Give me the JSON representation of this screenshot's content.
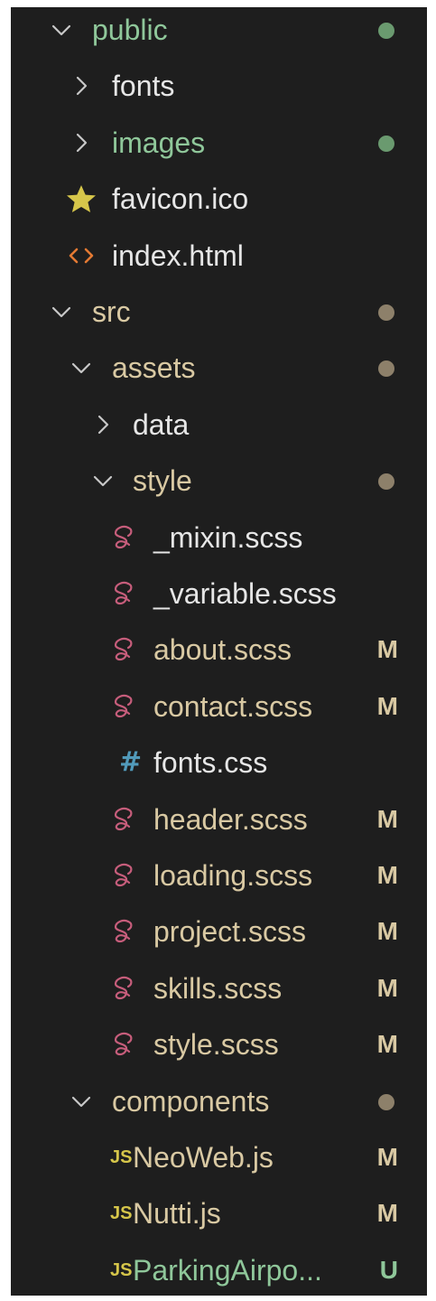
{
  "colors": {
    "bg": "#1e1e1e",
    "green": "#8fc79a",
    "green_dot": "#6a9a6f",
    "tan": "#d9c9a3",
    "tan_dot": "#8d806a",
    "white": "#e6e6e6",
    "chevron": "#c8c8c8",
    "sass": "#c65d7b",
    "js": "#d6c64a",
    "css": "#519aba",
    "star": "#d6c64a",
    "html": "#e37933",
    "badge_m": "#d9c9a3",
    "badge_u": "#8fc79a"
  },
  "rows": [
    {
      "label": "public",
      "depth": 0,
      "type": "folder",
      "open": true,
      "color": "green",
      "dot": "green_dot"
    },
    {
      "label": "fonts",
      "depth": 1,
      "type": "folder",
      "open": false,
      "color": "white"
    },
    {
      "label": "images",
      "depth": 1,
      "type": "folder",
      "open": false,
      "color": "green",
      "dot": "green_dot"
    },
    {
      "label": "favicon.ico",
      "depth": 1,
      "type": "file",
      "icon": "star-icon",
      "color": "white"
    },
    {
      "label": "index.html",
      "depth": 1,
      "type": "file",
      "icon": "html-icon",
      "color": "white"
    },
    {
      "label": "src",
      "depth": 0,
      "type": "folder",
      "open": true,
      "color": "tan",
      "dot": "tan_dot"
    },
    {
      "label": "assets",
      "depth": 1,
      "type": "folder",
      "open": true,
      "color": "tan",
      "dot": "tan_dot"
    },
    {
      "label": "data",
      "depth": 2,
      "type": "folder",
      "open": false,
      "color": "white"
    },
    {
      "label": "style",
      "depth": 2,
      "type": "folder",
      "open": true,
      "color": "tan",
      "dot": "tan_dot"
    },
    {
      "label": "_mixin.scss",
      "depth": 3,
      "type": "file",
      "icon": "sass-icon",
      "color": "white"
    },
    {
      "label": "_variable.scss",
      "depth": 3,
      "type": "file",
      "icon": "sass-icon",
      "color": "white"
    },
    {
      "label": "about.scss",
      "depth": 3,
      "type": "file",
      "icon": "sass-icon",
      "color": "tan",
      "badge": "M"
    },
    {
      "label": "contact.scss",
      "depth": 3,
      "type": "file",
      "icon": "sass-icon",
      "color": "tan",
      "badge": "M"
    },
    {
      "label": "fonts.css",
      "depth": 3,
      "type": "file",
      "icon": "css-icon",
      "color": "white"
    },
    {
      "label": "header.scss",
      "depth": 3,
      "type": "file",
      "icon": "sass-icon",
      "color": "tan",
      "badge": "M"
    },
    {
      "label": "loading.scss",
      "depth": 3,
      "type": "file",
      "icon": "sass-icon",
      "color": "tan",
      "badge": "M"
    },
    {
      "label": "project.scss",
      "depth": 3,
      "type": "file",
      "icon": "sass-icon",
      "color": "tan",
      "badge": "M"
    },
    {
      "label": "skills.scss",
      "depth": 3,
      "type": "file",
      "icon": "sass-icon",
      "color": "tan",
      "badge": "M"
    },
    {
      "label": "style.scss",
      "depth": 3,
      "type": "file",
      "icon": "sass-icon",
      "color": "tan",
      "badge": "M"
    },
    {
      "label": "components",
      "depth": 1,
      "type": "folder",
      "open": true,
      "color": "tan",
      "dot": "tan_dot"
    },
    {
      "label": "NeoWeb.js",
      "depth": 2,
      "type": "file",
      "icon": "js-icon",
      "color": "tan",
      "badge": "M"
    },
    {
      "label": "Nutti.js",
      "depth": 2,
      "type": "file",
      "icon": "js-icon",
      "color": "tan",
      "badge": "M"
    },
    {
      "label": "ParkingAirpo...",
      "depth": 2,
      "type": "file",
      "icon": "js-icon",
      "color": "green",
      "badge": "U"
    }
  ],
  "icon_text": {
    "js": "JS",
    "css": "#"
  }
}
